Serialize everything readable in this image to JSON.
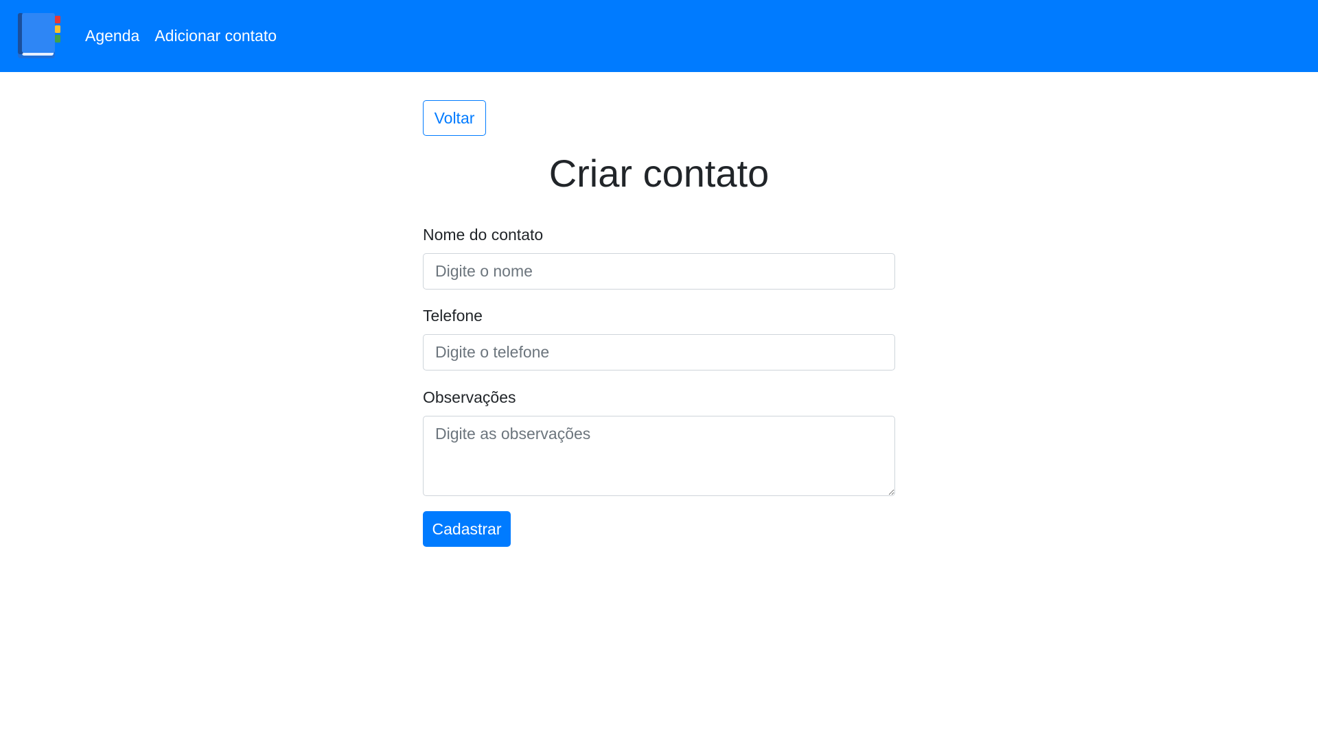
{
  "navbar": {
    "logo_icon": "address-book-icon",
    "links": [
      {
        "label": "Agenda"
      },
      {
        "label": "Adicionar contato"
      }
    ],
    "background_color": "#007bff"
  },
  "page": {
    "back_button_label": "Voltar",
    "title": "Criar contato"
  },
  "form": {
    "name": {
      "label": "Nome do contato",
      "value": "",
      "placeholder": "Digite o nome"
    },
    "phone": {
      "label": "Telefone",
      "value": "",
      "placeholder": "Digite o telefone"
    },
    "notes": {
      "label": "Observações",
      "value": "",
      "placeholder": "Digite as observações"
    },
    "submit_label": "Cadastrar"
  },
  "colors": {
    "primary": "#007bff",
    "text": "#212529",
    "placeholder": "#6c757d",
    "input_border": "#ced4da"
  }
}
